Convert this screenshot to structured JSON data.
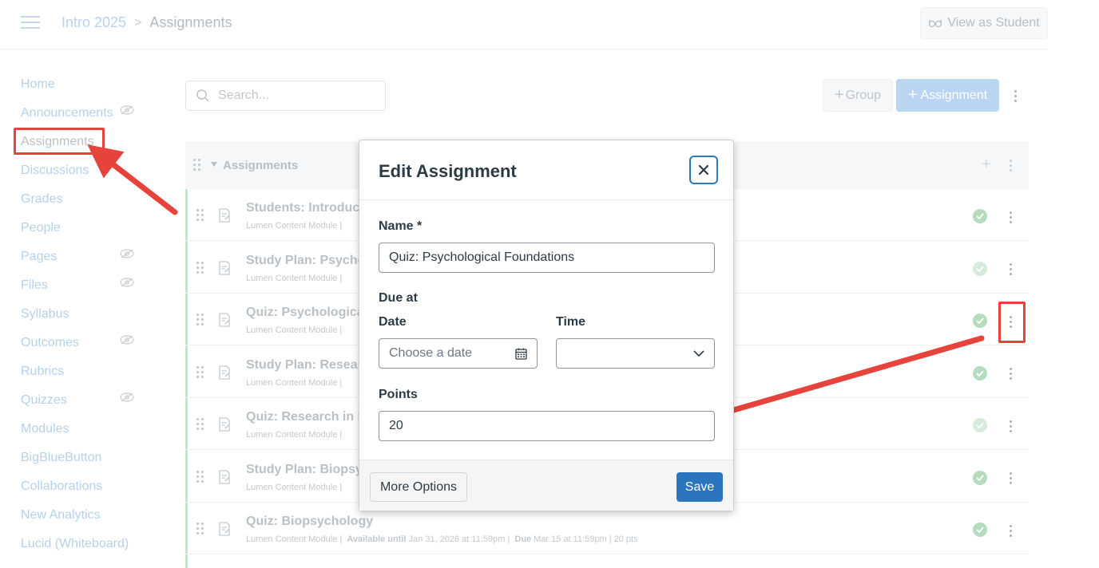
{
  "header": {
    "course": "Intro 2025",
    "separator": ">",
    "current": "Assignments",
    "view_as_student": "View as Student"
  },
  "sidebar": {
    "items": [
      {
        "label": "Home",
        "hidden_eye": false
      },
      {
        "label": "Announcements",
        "hidden_eye": true
      },
      {
        "label": "Assignments",
        "hidden_eye": false,
        "active": true
      },
      {
        "label": "Discussions",
        "hidden_eye": false
      },
      {
        "label": "Grades",
        "hidden_eye": false
      },
      {
        "label": "People",
        "hidden_eye": false
      },
      {
        "label": "Pages",
        "hidden_eye": true
      },
      {
        "label": "Files",
        "hidden_eye": true
      },
      {
        "label": "Syllabus",
        "hidden_eye": false
      },
      {
        "label": "Outcomes",
        "hidden_eye": true
      },
      {
        "label": "Rubrics",
        "hidden_eye": false
      },
      {
        "label": "Quizzes",
        "hidden_eye": true
      },
      {
        "label": "Modules",
        "hidden_eye": false
      },
      {
        "label": "BigBlueButton",
        "hidden_eye": false
      },
      {
        "label": "Collaborations",
        "hidden_eye": false
      },
      {
        "label": "New Analytics",
        "hidden_eye": false
      },
      {
        "label": "Lucid (Whiteboard)",
        "hidden_eye": false
      }
    ]
  },
  "toolbar": {
    "search_placeholder": "Search...",
    "group_label": "Group",
    "assignment_label": "Assignment"
  },
  "group": {
    "title": "Assignments",
    "rows": [
      {
        "title": "Students: Introduce",
        "meta": "Lumen Content Module  |",
        "check": "published"
      },
      {
        "title": "Study Plan: Psychol",
        "meta": "Lumen Content Module  |",
        "check": "faint"
      },
      {
        "title": "Quiz: Psychological",
        "meta": "Lumen Content Module  |",
        "check": "published"
      },
      {
        "title": "Study Plan: Research",
        "meta": "Lumen Content Module  |",
        "check": "published"
      },
      {
        "title": "Quiz: Research in Ps",
        "meta": "Lumen Content Module  |",
        "check": "faint"
      },
      {
        "title": "Study Plan: Biopsych",
        "meta": "Lumen Content Module  |",
        "check": "published"
      },
      {
        "title": "Quiz: Biopsychology",
        "meta_prefix": "Lumen Content Module  |  ",
        "meta_avail_label": "Available until",
        "meta_avail": "Jan 31, 2026 at 11:59pm",
        "meta_sep": "  |  ",
        "meta_due_label": "Due",
        "meta_due": "Mar 15 at 11:59pm",
        "meta_pts": "  |  20 pts",
        "check": "published"
      }
    ]
  },
  "modal": {
    "title": "Edit Assignment",
    "name_label": "Name *",
    "name_value": "Quiz: Psychological Foundations",
    "due_label": "Due at",
    "date_label": "Date",
    "date_placeholder": "Choose a date",
    "time_label": "Time",
    "time_value": "",
    "points_label": "Points",
    "points_value": "20",
    "more_options": "More Options",
    "save": "Save"
  },
  "colors": {
    "annotation": "#e5433b",
    "primary": "#2b74be",
    "published": "#b6dcc0"
  }
}
